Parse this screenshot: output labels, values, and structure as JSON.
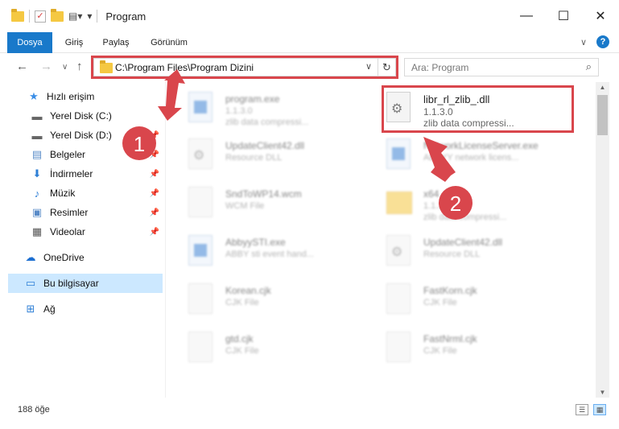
{
  "window": {
    "title": "Program"
  },
  "ribbon": {
    "tabs": [
      {
        "label": "Dosya"
      },
      {
        "label": "Giriş"
      },
      {
        "label": "Paylaş"
      },
      {
        "label": "Görünüm"
      }
    ],
    "help": "?"
  },
  "address": {
    "path": "C:\\Program Files\\Program Dizini"
  },
  "search": {
    "placeholder": "Ara: Program"
  },
  "sidebar": {
    "items": [
      {
        "label": "Hızlı erişim"
      },
      {
        "label": "Yerel Disk (C:)"
      },
      {
        "label": "Yerel Disk (D:)"
      },
      {
        "label": "Belgeler"
      },
      {
        "label": "İndirmeler"
      },
      {
        "label": "Müzik"
      },
      {
        "label": "Resimler"
      },
      {
        "label": "Videolar"
      },
      {
        "label": "OneDrive"
      },
      {
        "label": "Bu bilgisayar"
      },
      {
        "label": "Ağ"
      }
    ]
  },
  "files": [
    {
      "name": "program.exe",
      "line2": "1.1.3.0",
      "line3": "zlib data compressi..."
    },
    {
      "name": "libr_rl_zlib_.dll",
      "line2": "1.1.3.0",
      "line3": "zlib data compressi..."
    },
    {
      "name": "UpdateClient42.dll",
      "line2": "Resource DLL",
      "line3": ""
    },
    {
      "name": "NetworkLicenseServer.exe",
      "line2": "ABBYY network licens...",
      "line3": ""
    },
    {
      "name": "SndToWP14.wcm",
      "line2": "WCM File",
      "line3": ""
    },
    {
      "name": "x64",
      "line2": "1.1.3.0",
      "line3": "zlib data compressi..."
    },
    {
      "name": "AbbyySTI.exe",
      "line2": "ABBY sti event hand...",
      "line3": ""
    },
    {
      "name": "UpdateClient42.dll",
      "line2": "Resource DLL",
      "line3": ""
    },
    {
      "name": "Korean.cjk",
      "line2": "CJK File",
      "line3": ""
    },
    {
      "name": "FastKorn.cjk",
      "line2": "CJK File",
      "line3": ""
    },
    {
      "name": "gtd.cjk",
      "line2": "CJK File",
      "line3": ""
    },
    {
      "name": "FastNrml.cjk",
      "line2": "CJK File",
      "line3": ""
    }
  ],
  "status": {
    "count": "188 öğe"
  },
  "annotations": {
    "badge1": "1",
    "badge2": "2",
    "color": "#d9464c"
  }
}
